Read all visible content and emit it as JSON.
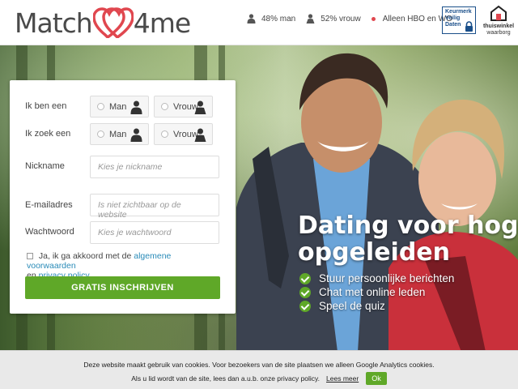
{
  "header": {
    "logo_text_left": "Match",
    "logo_text_right": "4me",
    "stats": [
      {
        "icon": "man-icon",
        "label": "48% man"
      },
      {
        "icon": "woman-icon",
        "label": "52% vrouw"
      },
      {
        "icon": "dot-icon",
        "label": "Alleen HBO en WO"
      }
    ],
    "badge1": {
      "line1": "Keurmerk",
      "line2": "Veilig",
      "line3": "Daten"
    },
    "badge2": {
      "line1": "thuiswinkel",
      "line2": "waarborg"
    }
  },
  "form": {
    "row1_label": "Ik ben een",
    "row2_label": "Ik zoek een",
    "man_label": "Man",
    "vrouw_label": "Vrouw",
    "nickname_label": "Nickname",
    "nickname_placeholder": "Kies je nickname",
    "email_label": "E-mailadres",
    "email_placeholder": "Is niet zichtbaar op de website",
    "password_label": "Wachtwoord",
    "password_placeholder": "Kies je wachtwoord",
    "agree_prefix": "Ja, ik ga akkoord met de",
    "agree_terms": "algemene voorwaarden",
    "agree_and": "en",
    "agree_privacy": "privacy policy",
    "submit_label": "GRATIS INSCHRIJVEN"
  },
  "hero": {
    "tagline_line1": "Dating voor hoger",
    "tagline_line2": "opgeleiden",
    "bullets": [
      "Stuur persoonlijke berichten",
      "Chat met online leden",
      "Speel de quiz"
    ]
  },
  "cookie": {
    "line1": "Deze website maakt gebruik van cookies. Voor bezoekers van de site plaatsen we alleen Google Analytics cookies.",
    "line2": "Als u lid wordt van de site, lees dan a.u.b. onze privacy policy.",
    "more_label": "Lees meer",
    "ok_label": "Ok"
  },
  "colors": {
    "brand_pink": "#e0474f",
    "accent_green": "#5fa828",
    "link_blue": "#2a8bb8"
  }
}
